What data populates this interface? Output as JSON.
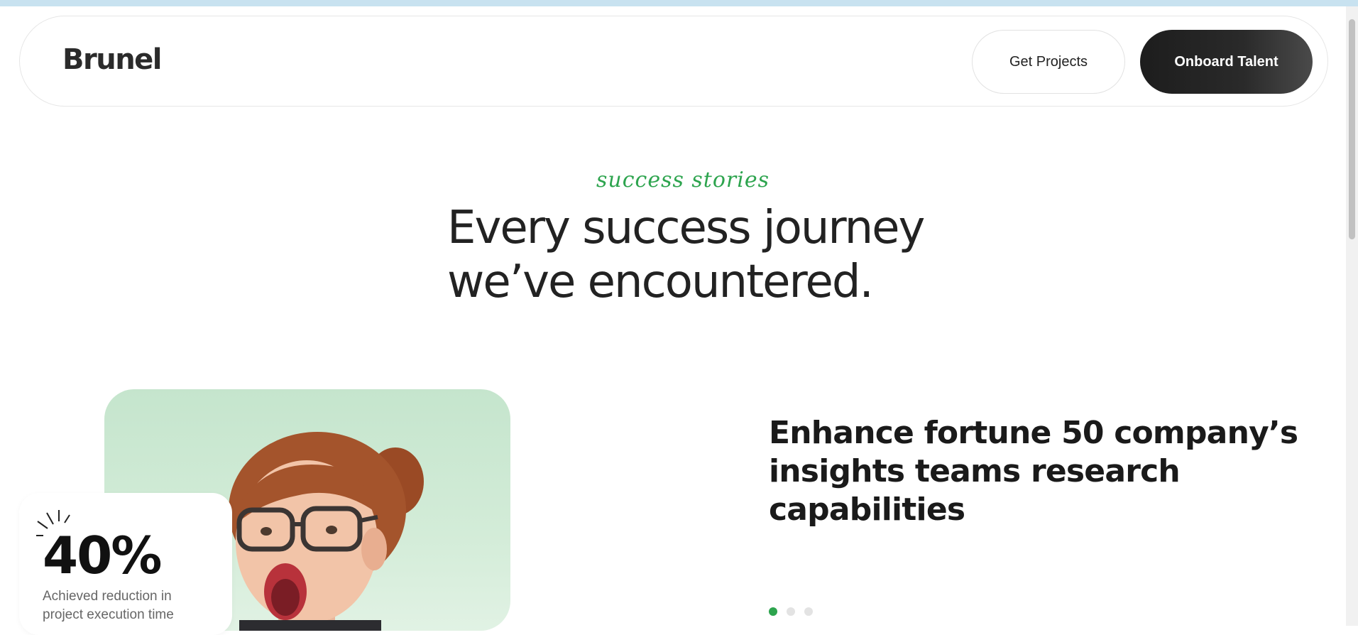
{
  "brand": {
    "logo_text": "Brunel"
  },
  "nav": {
    "get_projects_label": "Get Projects",
    "onboard_talent_label": "Onboard Talent"
  },
  "hero": {
    "eyebrow": "success stories",
    "headline_line1": "Every success journey",
    "headline_line2": "we’ve encountered."
  },
  "stat": {
    "value": "40%",
    "desc_line1": "Achieved reduction in",
    "desc_line2": "project execution time"
  },
  "story": {
    "title_line1": "Enhance fortune 50 company’s",
    "title_line2": "insights teams research",
    "title_line3": "capabilities"
  },
  "carousel": {
    "count": 3,
    "active_index": 0
  },
  "colors": {
    "accent_green": "#2da44e",
    "dark_button": "#1d1d1d",
    "photo_bg": "#c5e5cd"
  },
  "icons": [
    "spark-icon"
  ]
}
